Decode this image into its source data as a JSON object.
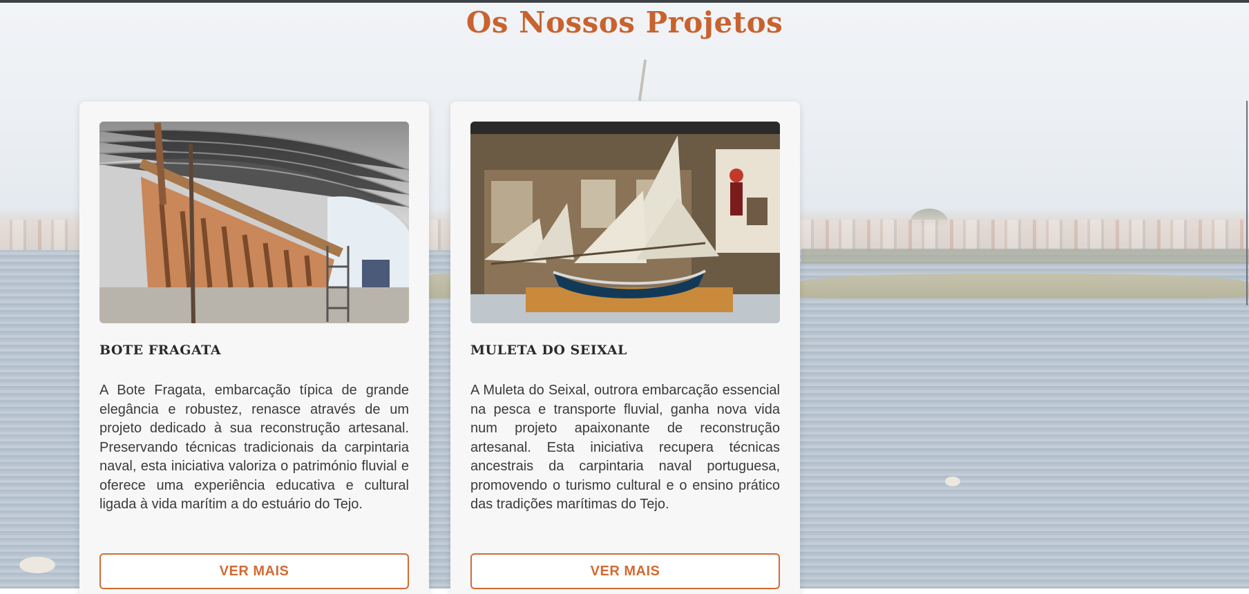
{
  "section": {
    "title": "Os Nossos Projetos"
  },
  "projects": [
    {
      "title": "BOTE FRAGATA",
      "image_alt": "Bote Fragata em reconstrução no estaleiro",
      "description": "A Bote Fragata, embarcação típica de grande elegância e robustez, renasce através de um projeto dedicado à sua reconstrução artesanal. Preservando técnicas tradicionais da carpintaria naval, esta iniciativa valoriza o património fluvial e oferece uma experiência educativa e cultural ligada à vida marítim a do estuário do Tejo.",
      "button": "VER MAIS"
    },
    {
      "title": "MULETA DO SEIXAL",
      "image_alt": "Maqueta da Muleta do Seixal em exposição",
      "description": "A Muleta do Seixal, outrora embarcação essencial na pesca e transporte fluvial, ganha nova vida num projeto apaixonante de reconstrução artesanal. Esta iniciativa recupera técnicas ancestrais da carpintaria naval portuguesa, promovendo o turismo cultural e o ensino prático das tradições marítimas do Tejo.",
      "button": "VER MAIS"
    }
  ],
  "colors": {
    "accent": "#c8622e",
    "button_border": "#d26a34"
  }
}
